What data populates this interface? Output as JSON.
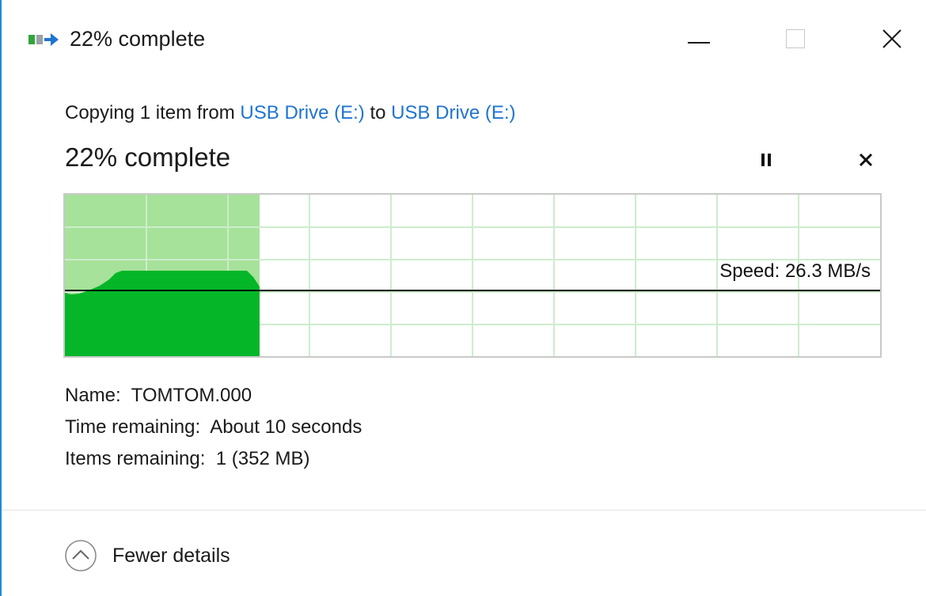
{
  "window": {
    "title": "22% complete",
    "icon": "file-copy-icon",
    "controls": [
      "minimize-icon",
      "maximize-icon",
      "close-icon"
    ]
  },
  "copy": {
    "prefix": "Copying 1 item from",
    "source": "USB Drive (E:)",
    "middle": "to",
    "destination": "USB Drive (E:)"
  },
  "progress": {
    "heading": "22% complete",
    "percent": 22,
    "pause_icon": "pause-icon",
    "cancel_icon": "cancel-icon"
  },
  "speed": {
    "label": "Speed: 26.3 MB/s"
  },
  "details": {
    "name_label": "Name:",
    "name_value": "TOMTOM.000",
    "time_label": "Time remaining:",
    "time_value": "About 10 seconds",
    "items_label": "Items remaining:",
    "items_value": "1 (352 MB)"
  },
  "footer": {
    "toggle_label": "Fewer details",
    "toggle_icon": "chevron-up-circle-icon"
  },
  "colors": {
    "accent_link": "#1f74d0",
    "progress_fill": "#a6e29a",
    "speed_fill": "#05b628",
    "grid": "#cdeccd",
    "window_border": "#1f8ad6"
  }
}
